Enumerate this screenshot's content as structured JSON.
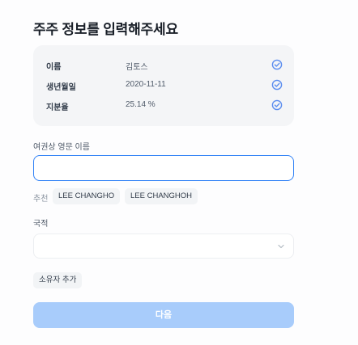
{
  "title": "주주 정보를 입력해주세요",
  "summary": {
    "rows": [
      {
        "label": "이름",
        "value": "김토스"
      },
      {
        "label": "생년월일",
        "value": "2020-11-11"
      },
      {
        "label": "지분율",
        "value": "25.14 %"
      }
    ],
    "check_icon": "check-circle-icon",
    "check_color": "#5b8def"
  },
  "name_field": {
    "label": "여권상 영문 이름",
    "value": "",
    "placeholder": ""
  },
  "suggestions": {
    "label": "추천",
    "items": [
      "LEE CHANGHO",
      "LEE CHANGHOH"
    ]
  },
  "nationality": {
    "label": "국적",
    "selected": ""
  },
  "add_owner_label": "소유자 추가",
  "next_label": "다음",
  "colors": {
    "accent": "#3182f6",
    "button_disabled": "#a8ccfb",
    "card_bg": "#f4f5f7"
  }
}
